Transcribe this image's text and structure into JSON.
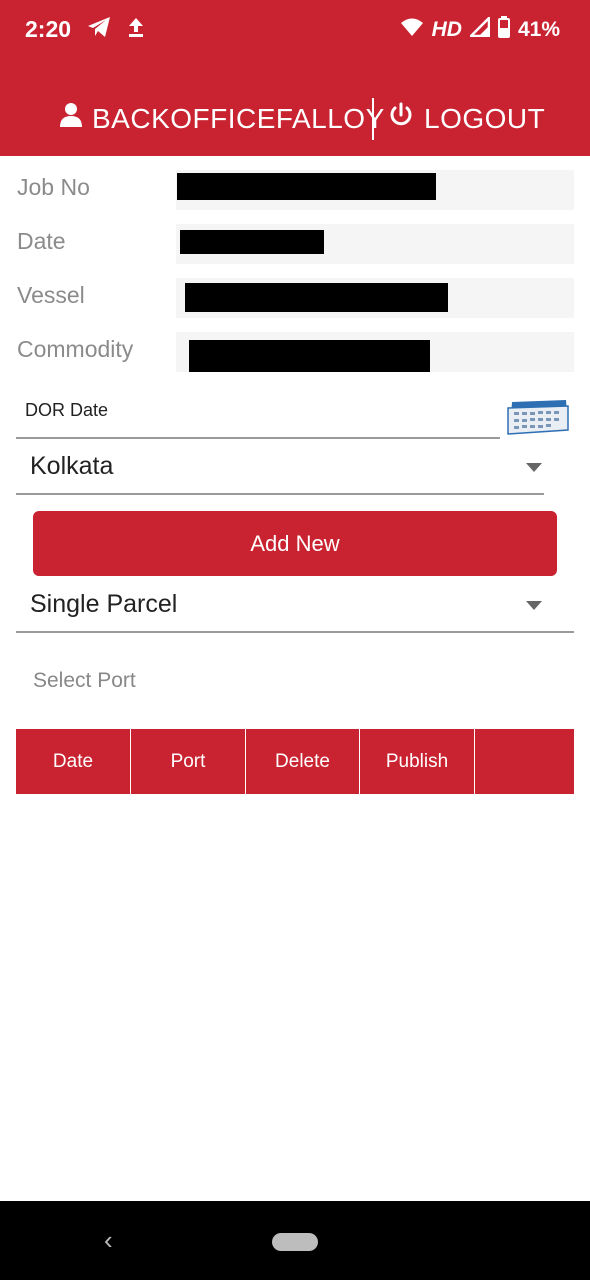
{
  "status_bar": {
    "time": "2:20",
    "network_label": "HD",
    "battery": "41%",
    "icons": [
      "telegram-icon",
      "upload-icon",
      "wifi-icon",
      "signal-icon",
      "battery-icon"
    ]
  },
  "header": {
    "username": "BACKOFFICEFALLOY",
    "logout_label": "LOGOUT",
    "background_color": "#c92331"
  },
  "details": {
    "job_no_label": "Job No",
    "date_label": "Date",
    "vessel_label": "Vessel",
    "commodity_label": "Commodity"
  },
  "dor_date": {
    "placeholder": "DOR Date"
  },
  "location_select": {
    "value": "Kolkata"
  },
  "add_new_button": {
    "label": "Add New"
  },
  "parcel_select": {
    "value": "Single Parcel"
  },
  "select_port": {
    "label": "Select Port"
  },
  "table": {
    "headers": [
      "Date",
      "Port",
      "Delete",
      "Publish",
      ""
    ]
  }
}
